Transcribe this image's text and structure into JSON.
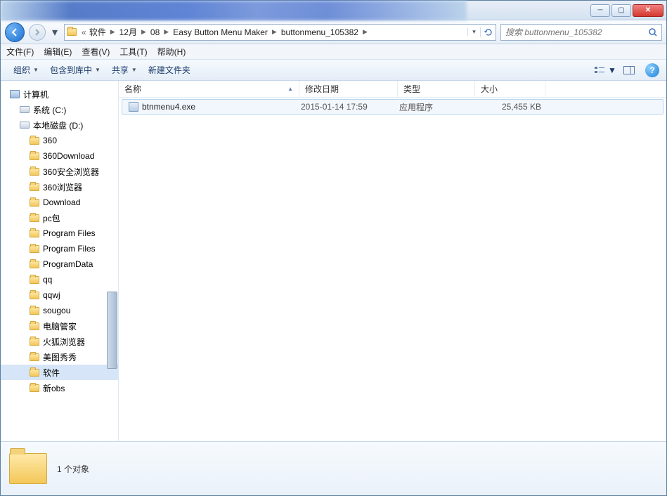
{
  "breadcrumb": {
    "prefix": "«",
    "segments": [
      "软件",
      "12月",
      "08",
      "Easy Button Menu Maker",
      "buttonmenu_105382"
    ]
  },
  "search": {
    "placeholder": "搜索 buttonmenu_105382"
  },
  "menubar": {
    "file": "文件(F)",
    "edit": "编辑(E)",
    "view": "查看(V)",
    "tools": "工具(T)",
    "help": "帮助(H)"
  },
  "toolbar": {
    "organize": "组织",
    "include": "包含到库中",
    "share": "共享",
    "newfolder": "新建文件夹"
  },
  "columns": {
    "name": "名称",
    "date": "修改日期",
    "type": "类型",
    "size": "大小"
  },
  "tree": {
    "computer": "计算机",
    "system_c": "系统 (C:)",
    "local_d": "本地磁盘 (D:)",
    "items": [
      "360",
      "360Download",
      "360安全浏览器",
      "360浏览器",
      "Download",
      "pc包",
      "Program Files",
      "Program Files",
      "ProgramData",
      "qq",
      "qqwj",
      "sougou",
      "电脑管家",
      "火狐浏览器",
      "美图秀秀",
      "软件",
      "新obs"
    ]
  },
  "files": [
    {
      "name": "btnmenu4.exe",
      "date": "2015-01-14 17:59",
      "type": "应用程序",
      "size": "25,455 KB"
    }
  ],
  "details": {
    "count": "1 个对象"
  }
}
